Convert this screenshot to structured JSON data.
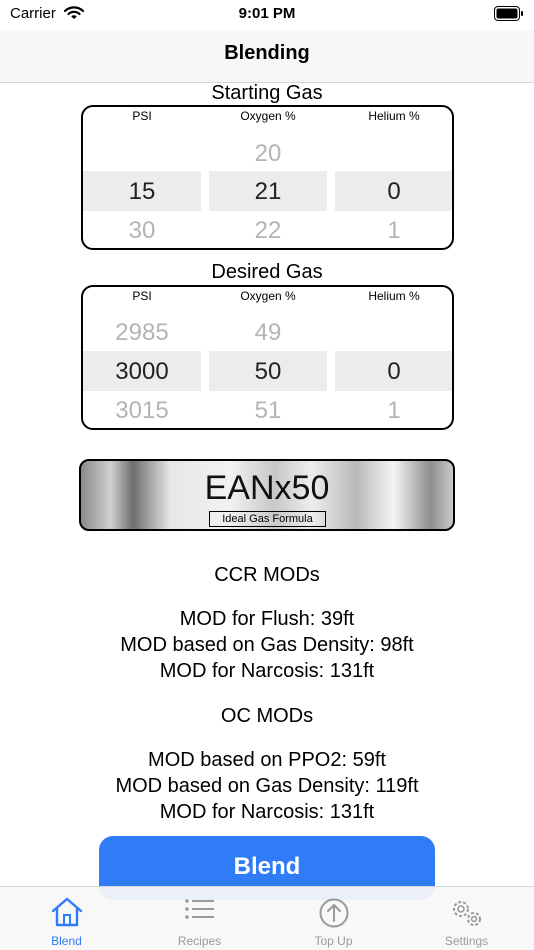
{
  "status": {
    "carrier": "Carrier",
    "time": "9:01 PM"
  },
  "nav": {
    "title": "Blending"
  },
  "starting_gas": {
    "label": "Starting Gas",
    "headers": [
      "PSI",
      "Oxygen %",
      "Helium %"
    ],
    "columns": [
      {
        "above": "",
        "selected": "15",
        "below": "30"
      },
      {
        "above": "20",
        "selected": "21",
        "below": "22"
      },
      {
        "above": "",
        "selected": "0",
        "below": "1"
      }
    ]
  },
  "desired_gas": {
    "label": "Desired Gas",
    "headers": [
      "PSI",
      "Oxygen %",
      "Helium %"
    ],
    "columns": [
      {
        "above": "2985",
        "selected": "3000",
        "below": "3015"
      },
      {
        "above": "49",
        "selected": "50",
        "below": "51"
      },
      {
        "above": "",
        "selected": "0",
        "below": "1"
      }
    ]
  },
  "mix": {
    "name": "EANx50",
    "formula": "Ideal Gas Formula"
  },
  "ccr": {
    "title": "CCR MODs",
    "lines": [
      "MOD for Flush: 39ft",
      "MOD based on Gas Density: 98ft",
      "MOD for Narcosis: 131ft"
    ]
  },
  "oc": {
    "title": "OC MODs",
    "lines": [
      "MOD based on PPO2: 59ft",
      "MOD based on Gas Density: 119ft",
      "MOD for Narcosis: 131ft"
    ]
  },
  "blend_button": {
    "label": "Blend",
    "color": "#2f7cf6"
  },
  "tabs": [
    {
      "label": "Blend",
      "icon": "house-icon",
      "active": true
    },
    {
      "label": "Recipes",
      "icon": "list-icon",
      "active": false
    },
    {
      "label": "Top Up",
      "icon": "arrow-up-circle-icon",
      "active": false
    },
    {
      "label": "Settings",
      "icon": "gears-icon",
      "active": false
    }
  ],
  "colors": {
    "accent": "#2f7cf6",
    "selection_band": "#ececec",
    "dim_value": "#b4b4b4"
  }
}
